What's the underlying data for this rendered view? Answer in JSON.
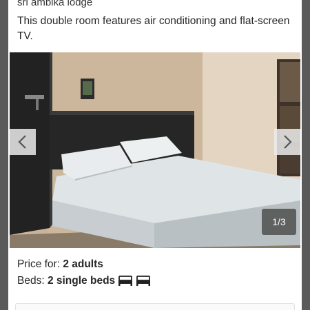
{
  "card": {
    "lodge_name": "sri ambika lodge",
    "description": "This double room features air conditioning and flat-screen TV."
  },
  "gallery": {
    "image_alt": "Double room with bed",
    "counter": "1/3",
    "prev_icon": "chevron-left-icon",
    "next_icon": "chevron-right-icon"
  },
  "info": {
    "price_label": "Price for:",
    "price_value": "2 adults",
    "beds_label": "Beds:",
    "beds_value": "2 single beds",
    "bed_icon": "single-bed-icon",
    "bed_icon_count": 2
  },
  "colors": {
    "card_background": "#ffffff",
    "overlay": "#2a2a2a",
    "text": "#262626"
  }
}
